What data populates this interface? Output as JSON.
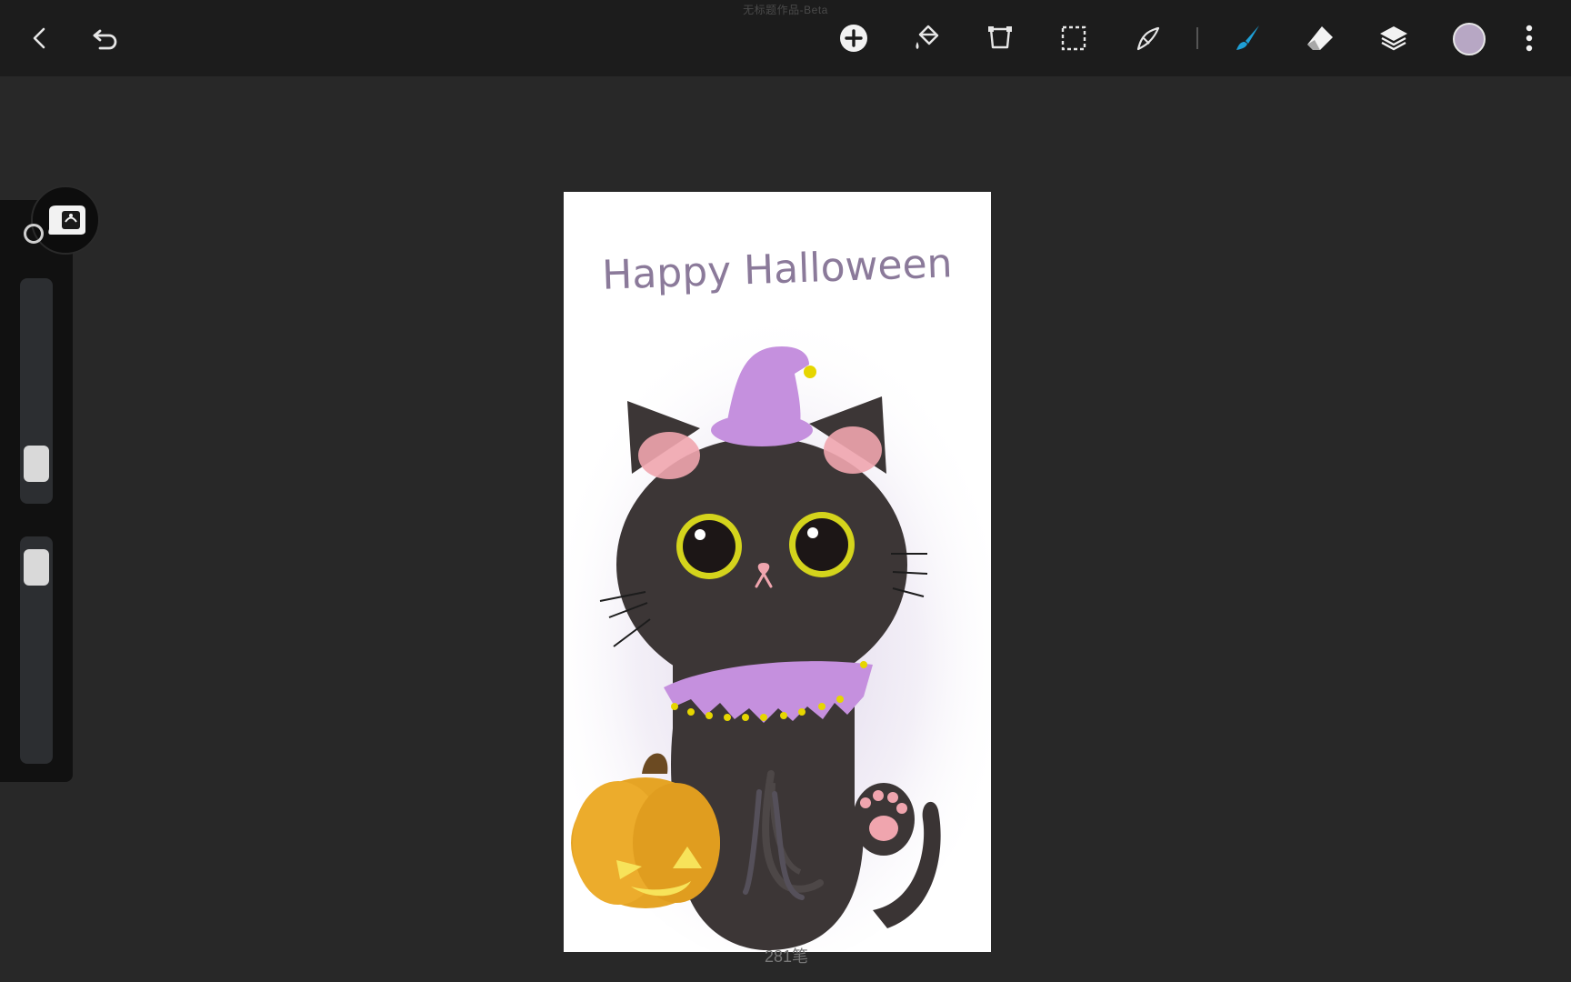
{
  "app": {
    "document_title": "无标题作品-Beta",
    "stroke_count": "281笔"
  },
  "toolbar": {
    "back": "back-icon",
    "undo": "undo-icon",
    "add": "add-icon",
    "fill": "paint-bucket-icon",
    "transform": "transform-icon",
    "selection": "selection-icon",
    "smudge": "smudge-icon",
    "brush": "brush-icon",
    "eraser": "eraser-icon",
    "layers": "layers-icon",
    "more": "more-icon",
    "current_color": "#b7a7c4",
    "brush_active_color": "#1e9fd6"
  },
  "sidebar": {
    "brush_size_level": 0.1,
    "opacity_level": 0.95
  },
  "artwork": {
    "caption": "Happy Halloween",
    "caption_color": "#8b7a9a"
  }
}
